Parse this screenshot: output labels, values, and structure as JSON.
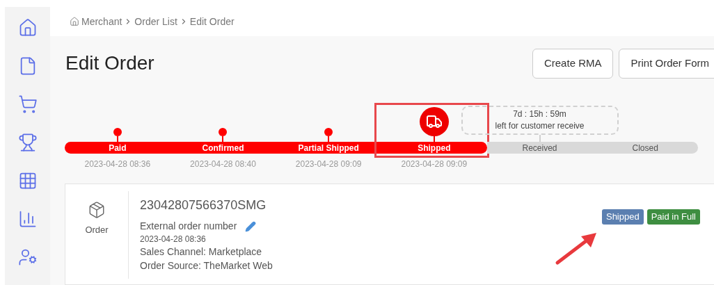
{
  "breadcrumb": [
    "Merchant",
    "Order List",
    "Edit Order"
  ],
  "title": "Edit Order",
  "actions": [
    "Create RMA",
    "Print Order Form"
  ],
  "timeline": {
    "steps": [
      {
        "label": "Paid",
        "date": "2023-04-28 08:36",
        "kind": "done",
        "highlighted": false
      },
      {
        "label": "Confirmed",
        "date": "2023-04-28 08:40",
        "kind": "done",
        "highlighted": false
      },
      {
        "label": "Partial Shipped",
        "date": "2023-04-28 09:09",
        "kind": "done",
        "highlighted": false
      },
      {
        "label": "Shipped",
        "date": "2023-04-28 09:09",
        "kind": "current",
        "highlighted": true
      },
      {
        "label": "Received",
        "kind": "pending",
        "highlighted": false,
        "countdown": {
          "time": "7d : 15h : 59m",
          "caption": "left for customer receive"
        }
      },
      {
        "label": "Closed",
        "kind": "pending",
        "highlighted": false
      }
    ]
  },
  "order": {
    "type_label": "Order",
    "number": "23042807566370SMG",
    "external_label": "External order number",
    "date": "2023-04-28 08:36",
    "lines": [
      "Sales Channel: Marketplace",
      "Order Source: TheMarket Web"
    ],
    "badges": [
      {
        "label": "Shipped",
        "color": "#5b7fb0"
      },
      {
        "label": "Paid in Full",
        "color": "#3e8e41"
      }
    ]
  }
}
